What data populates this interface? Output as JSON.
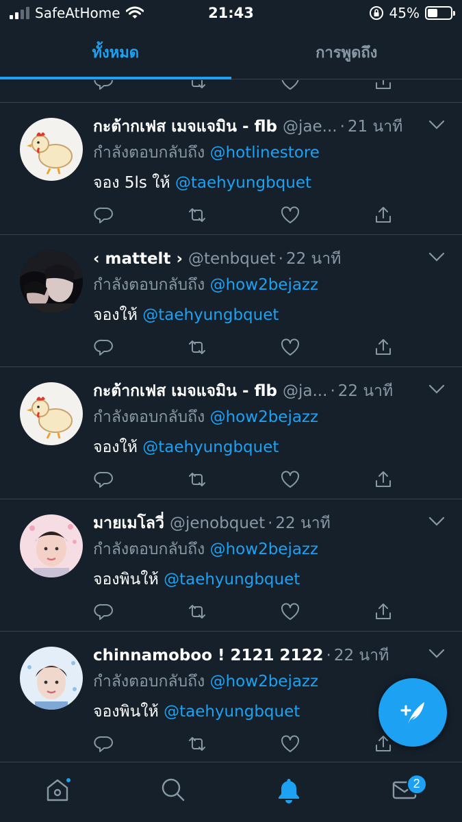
{
  "status_bar": {
    "carrier": "SafeAtHome",
    "time": "21:43",
    "battery_percent": "45%",
    "battery_level": 0.45
  },
  "tabs": [
    {
      "label": "ทั้งหมด",
      "active": true
    },
    {
      "label": "การพูดถึง",
      "active": false
    }
  ],
  "reply_prefix": "กำลังตอบกลับถึง",
  "tweets": [
    {
      "name": "กะต้ากเฟส เมจแจมิน - flb",
      "handle": "@jae...",
      "dot": "·",
      "time": "21 นาที",
      "reply_to": "@hotlinestore",
      "text": "จอง 5ls ให้",
      "mention": "@taehyungbquet",
      "avatar": "chicken"
    },
    {
      "name": "‹ mattelt ›",
      "handle": "@tenbquet",
      "dot": "·",
      "time": "22 นาที",
      "reply_to": "@how2bejazz",
      "text": "จองให้",
      "mention": "@taehyungbquet",
      "avatar": "dark-photo"
    },
    {
      "name": "กะต้ากเฟส เมจแจมิน - flb",
      "handle": "@ja...",
      "dot": "·",
      "time": "22 นาที",
      "reply_to": "@how2bejazz",
      "text": "จองให้",
      "mention": "@taehyungbquet",
      "avatar": "chicken"
    },
    {
      "name": "มายเมโลวี่",
      "handle": "@jenobquet",
      "dot": "·",
      "time": "22 นาที",
      "reply_to": "@how2bejazz",
      "text": "จองพินให้",
      "mention": "@taehyungbquet",
      "avatar": "pink-photo"
    },
    {
      "name": "chinnamoboo ! 2121 2122",
      "handle": "",
      "dot": "·",
      "time": "22 นาที",
      "reply_to": "@how2bejazz",
      "text": "จองพินให้",
      "mention": "@taehyungbquet",
      "avatar": "blue-photo"
    }
  ],
  "bottom_nav": {
    "notification_badge": "2"
  },
  "colors": {
    "background": "#15202b",
    "accent": "#1da1f2",
    "secondary_text": "#8899a6",
    "divider": "#38444d"
  }
}
